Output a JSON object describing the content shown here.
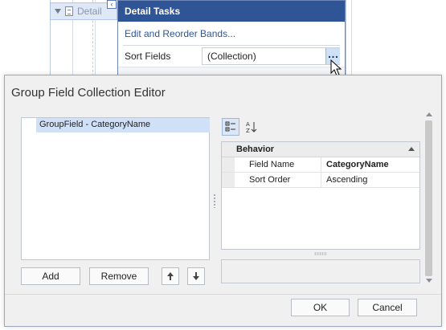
{
  "designer": {
    "band_label": "Detail"
  },
  "tasks_popup": {
    "title": "Detail Tasks",
    "link": "Edit and Reorder Bands...",
    "sort_fields_label": "Sort Fields",
    "sort_fields_value": "(Collection)",
    "ellipsis_label": "…"
  },
  "dialog": {
    "title": "Group Field Collection Editor",
    "items": [
      "GroupField - CategoryName"
    ],
    "add_label": "Add",
    "remove_label": "Remove",
    "move_up_icon": "arrow-up-icon",
    "move_down_icon": "arrow-down-icon",
    "property_grid": {
      "category": "Behavior",
      "properties": [
        {
          "name": "Field Name",
          "value": "CategoryName"
        },
        {
          "name": "Sort Order",
          "value": "Ascending"
        }
      ]
    },
    "ok_label": "OK",
    "cancel_label": "Cancel"
  },
  "colors": {
    "accent": "#2f5597",
    "selection": "#cfe0f7"
  }
}
